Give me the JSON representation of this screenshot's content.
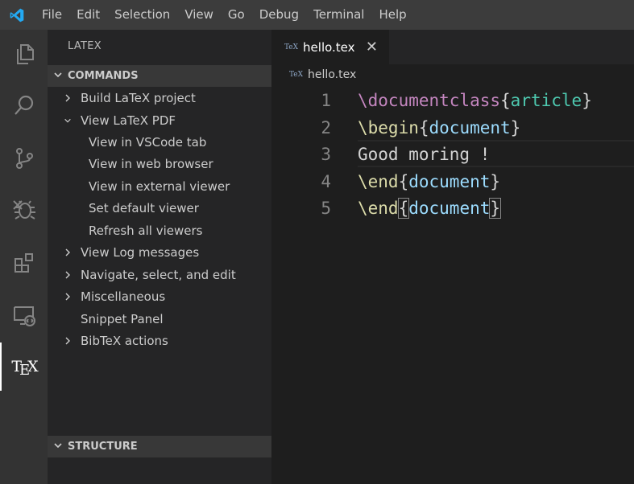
{
  "menu": [
    "File",
    "Edit",
    "Selection",
    "View",
    "Go",
    "Debug",
    "Terminal",
    "Help"
  ],
  "sidebar": {
    "title": "LATEX",
    "commands_header": "COMMANDS",
    "structure_header": "STRUCTURE",
    "items": [
      {
        "label": "Build LaTeX project",
        "twisty": "›",
        "level": 0
      },
      {
        "label": "View LaTeX PDF",
        "twisty": "⌄",
        "level": 0
      },
      {
        "label": "View in VSCode tab",
        "twisty": "",
        "level": 1
      },
      {
        "label": "View in web browser",
        "twisty": "",
        "level": 1
      },
      {
        "label": "View in external viewer",
        "twisty": "",
        "level": 1
      },
      {
        "label": "Set default viewer",
        "twisty": "",
        "level": 1
      },
      {
        "label": "Refresh all viewers",
        "twisty": "",
        "level": 1
      },
      {
        "label": "View Log messages",
        "twisty": "›",
        "level": 0
      },
      {
        "label": "Navigate, select, and edit",
        "twisty": "›",
        "level": 0
      },
      {
        "label": "Miscellaneous",
        "twisty": "›",
        "level": 0
      },
      {
        "label": "Snippet Panel",
        "twisty": "",
        "level": 0
      },
      {
        "label": "BibTeX actions",
        "twisty": "›",
        "level": 0
      }
    ]
  },
  "activity": {
    "icons": [
      "explorer-icon",
      "search-icon",
      "source-control-icon",
      "debug-icon",
      "extensions-icon",
      "remote-explorer-icon",
      "tex-icon"
    ],
    "tex_label_t": "T",
    "tex_label_e": "E",
    "tex_label_x": "X"
  },
  "editor": {
    "tab_label": "hello.tex",
    "tab_icon": "TeX",
    "tab_close": "✕",
    "breadcrumb": "hello.tex",
    "breadcrumb_icon": "TeX",
    "lines": [
      {
        "n": "1",
        "tokens": [
          {
            "t": "\\documentclass",
            "c": "kw"
          },
          {
            "t": "{",
            "c": "br"
          },
          {
            "t": "article",
            "c": "arg1"
          },
          {
            "t": "}",
            "c": "br"
          }
        ]
      },
      {
        "n": "2",
        "tokens": [
          {
            "t": "\\begin",
            "c": "kw2"
          },
          {
            "t": "{",
            "c": "br"
          },
          {
            "t": "document",
            "c": "arg"
          },
          {
            "t": "}",
            "c": "br"
          }
        ]
      },
      {
        "n": "3",
        "tokens": [
          {
            "t": "Good moring !",
            "c": ""
          }
        ]
      },
      {
        "n": "4",
        "tokens": [
          {
            "t": "\\end",
            "c": "kw2"
          },
          {
            "t": "{",
            "c": "br"
          },
          {
            "t": "document",
            "c": "arg"
          },
          {
            "t": "}",
            "c": "br"
          }
        ]
      },
      {
        "n": "5",
        "tokens": [
          {
            "t": "\\end",
            "c": "kw2"
          },
          {
            "t": "{",
            "c": "br match"
          },
          {
            "t": "document",
            "c": "arg"
          },
          {
            "t": "}",
            "c": "br match"
          }
        ]
      }
    ]
  }
}
